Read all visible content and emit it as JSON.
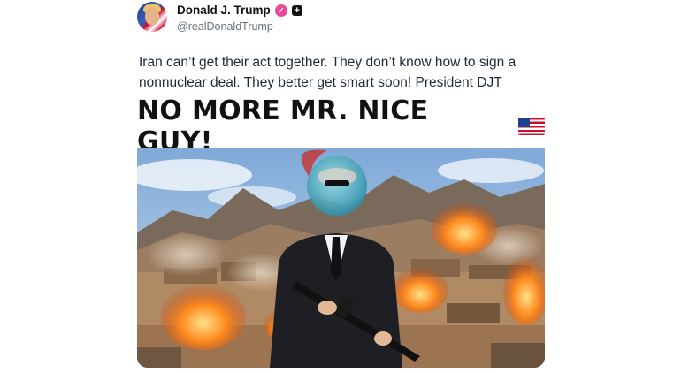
{
  "author": {
    "display_name": "Donald J. Trump",
    "handle": "@realDonaldTrump",
    "verified_icon": "check-badge-icon",
    "plus_icon": "plus-badge-icon"
  },
  "post": {
    "text": "Iran can’t get their act together. They don’t know how to sign a nonnuclear deal. They better get smart soon! President DJT"
  },
  "media": {
    "caption": "NO MORE MR. NICE GUY!",
    "flag_icon": "us-flag-icon"
  },
  "colors": {
    "verified": "#ec4899",
    "text": "#1f2937",
    "muted": "#6b7280"
  }
}
